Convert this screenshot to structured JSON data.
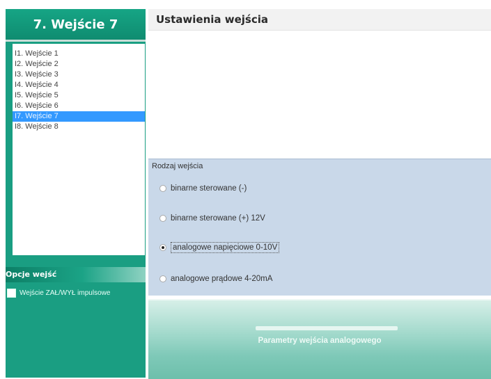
{
  "header": {
    "title": "7. Wejście 7"
  },
  "input_list": {
    "items": [
      {
        "label": "I1. Wejście 1",
        "selected": false
      },
      {
        "label": "I2. Wejście 2",
        "selected": false
      },
      {
        "label": "I3. Wejście 3",
        "selected": false
      },
      {
        "label": "I4. Wejście 4",
        "selected": false
      },
      {
        "label": "I5. Wejście 5",
        "selected": false
      },
      {
        "label": "I6. Wejście 6",
        "selected": false
      },
      {
        "label": "I7. Wejście 7",
        "selected": true
      },
      {
        "label": "I8. Wejście 8",
        "selected": false
      }
    ]
  },
  "options": {
    "title": "Opcje wejść",
    "impulse_checkbox": {
      "label": "Wejście ZAŁ/WYŁ impulsowe",
      "checked": false
    }
  },
  "settings": {
    "title": "Ustawienia wejścia",
    "input_type": {
      "legend": "Rodzaj wejścia",
      "options": [
        {
          "label": "binarne sterowane (-)",
          "checked": false
        },
        {
          "label": "binarne sterowane (+) 12V",
          "checked": false
        },
        {
          "label": "analogowe napięciowe 0-10V",
          "checked": true
        },
        {
          "label": "analogowe prądowe 4-20mA",
          "checked": false
        }
      ]
    }
  },
  "analog_panel": {
    "label": "Parametry wejścia analogowego"
  },
  "colors": {
    "accent_green": "#1a9e82",
    "selection_blue": "#3399ff",
    "group_bg": "#c9d8e9"
  }
}
